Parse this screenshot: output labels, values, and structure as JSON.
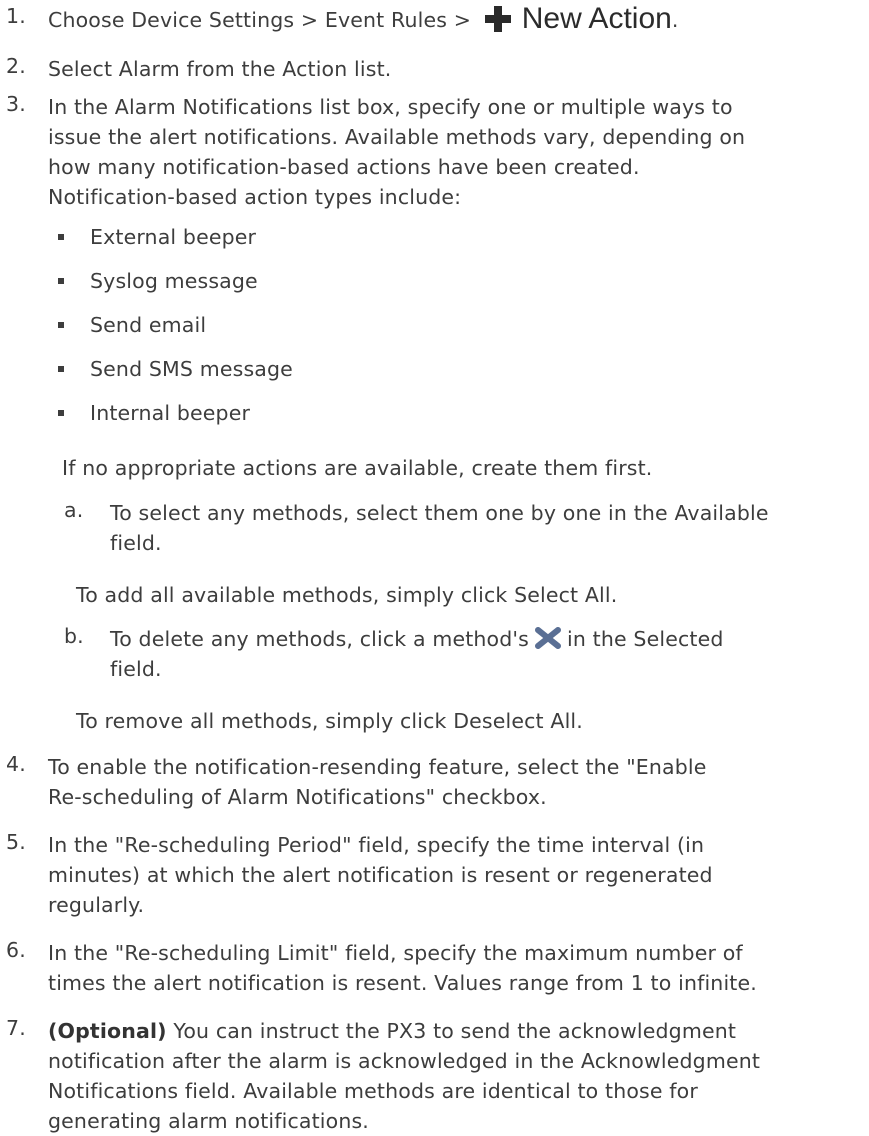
{
  "steps": [
    {
      "num": "1.",
      "lines": [
        "Choose Device Settings > Event Rules >"
      ],
      "button_label": "New Action",
      "trailing": "."
    },
    {
      "num": "2.",
      "lines": [
        "Select Alarm from the Action list."
      ]
    },
    {
      "num": "3.",
      "lines": [
        "In the Alarm Notifications list box, specify one or multiple ways to",
        "issue the alert notifications. Available methods vary, depending on",
        "how many notification-based actions have been created.",
        "Notification-based action types include:"
      ],
      "bullets": [
        "External beeper",
        "Syslog message",
        "Send email",
        "Send SMS message",
        "Internal beeper"
      ],
      "note": "If no appropriate actions are available, create them first.",
      "substeps": [
        {
          "letter": "a.",
          "lines": [
            "To select any methods, select them one by one in the Available",
            "field."
          ],
          "note": "To add all available methods, simply click Select All."
        },
        {
          "letter": "b.",
          "pre": "To delete any methods, click a method's",
          "post": "in the Selected",
          "lines": [
            "field."
          ],
          "note": "To remove all methods, simply click Deselect All."
        }
      ]
    },
    {
      "num": "4.",
      "lines": [
        "To enable the notification-resending feature, select the \"Enable",
        "Re-scheduling of Alarm Notifications\" checkbox."
      ]
    },
    {
      "num": "5.",
      "lines": [
        "In the \"Re-scheduling Period\" field, specify the time interval (in",
        "minutes) at which the alert notification is resent or regenerated",
        "regularly."
      ]
    },
    {
      "num": "6.",
      "lines": [
        "In the \"Re-scheduling Limit\" field, specify the maximum number of",
        "times the alert notification is resent. Values range from 1 to infinite."
      ]
    },
    {
      "num": "7.",
      "bold": "(Optional)",
      "first": "You can instruct the PX3 to send the acknowledgment",
      "lines": [
        "notification after the alarm is acknowledged in the Acknowledgment",
        "Notifications field. Available methods are identical to those for",
        "generating alarm notifications."
      ]
    }
  ],
  "colors": {
    "text": "#3d3d3d",
    "plus_icon": "#2a2a2a",
    "x_icon": "#5a6f94"
  }
}
